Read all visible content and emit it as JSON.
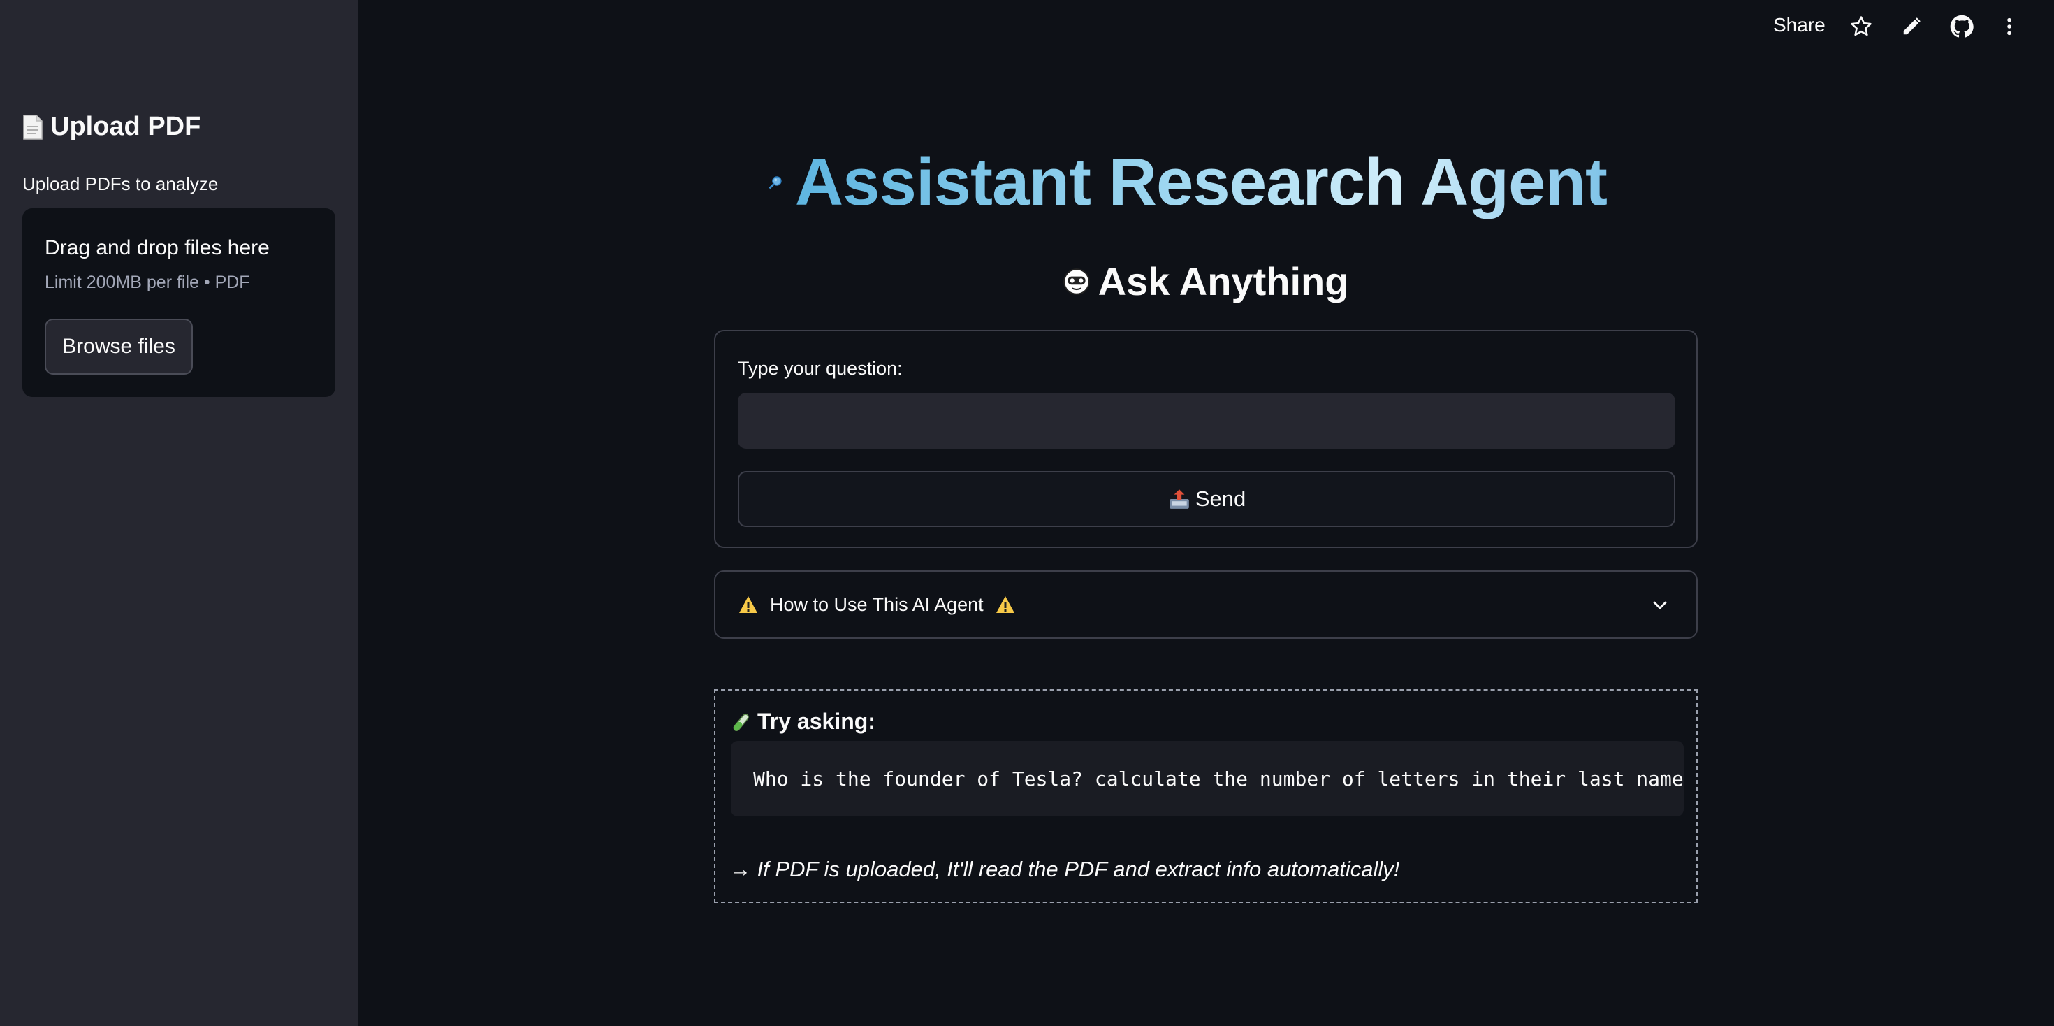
{
  "sidebar": {
    "title": "Upload PDF",
    "label": "Upload PDFs to analyze",
    "dropzone": {
      "title": "Drag and drop files here",
      "subtitle": "Limit 200MB per file • PDF",
      "browse_label": "Browse files"
    }
  },
  "toolbar": {
    "share_label": "Share",
    "icons": [
      "star-icon",
      "pencil-icon",
      "github-icon",
      "more-vertical-icon"
    ]
  },
  "main": {
    "title": "Assistant Research Agent",
    "title_icon": "magnifying-glass-icon",
    "subheading": "Ask Anything",
    "subheading_icon": "robot-face-icon",
    "form": {
      "label": "Type your question:",
      "input_value": "",
      "input_placeholder": "",
      "send_label": "Send",
      "send_icon": "outbox-tray-icon"
    },
    "expander": {
      "label": "How to Use This AI Agent",
      "icon": "warning-icon"
    },
    "try_box": {
      "title": "Try asking:",
      "title_icon": "test-tube-icon",
      "example": "Who is the founder of Tesla? calculate the number of letters in their last name",
      "note": "→ If PDF is uploaded, It'll read the PDF and extract info automatically!"
    }
  },
  "colors": {
    "background": "#0e1117",
    "sidebar": "#262730",
    "accent_title": "#87ceeb",
    "border": "#3d3f4a"
  }
}
